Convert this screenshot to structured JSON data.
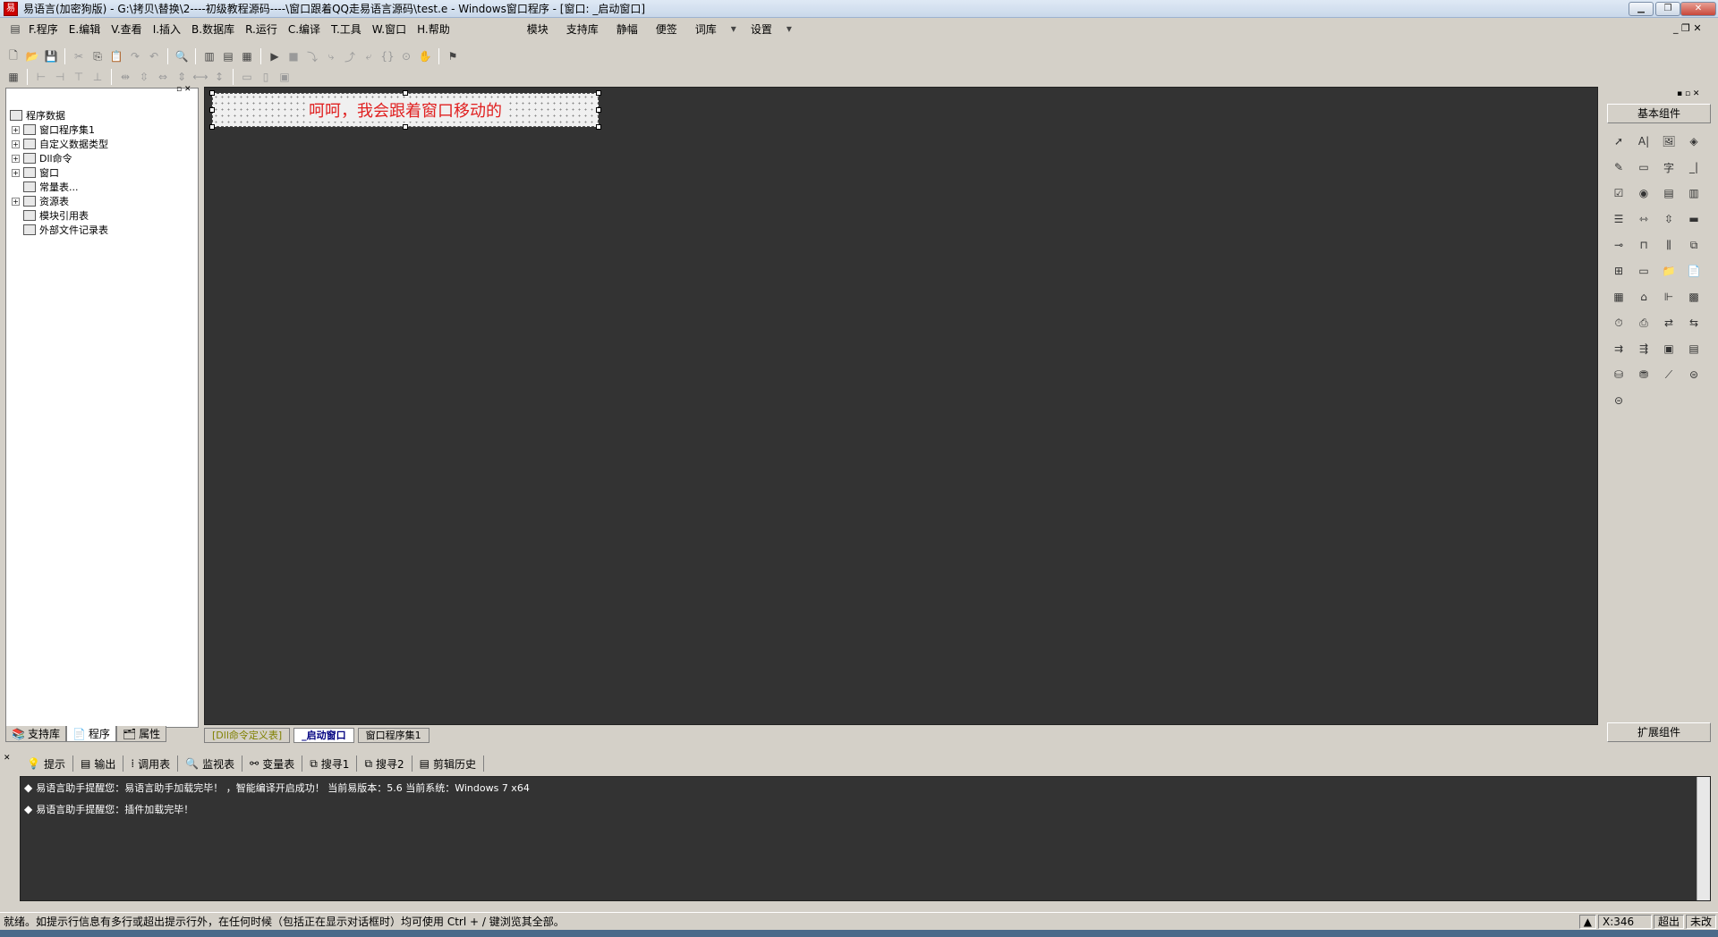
{
  "window": {
    "title": "易语言(加密狗版) - G:\\拷贝\\替换\\2----初级教程源码----\\窗口跟着QQ走易语言源码\\test.e - Windows窗口程序 - [窗口: _启动窗口]",
    "app_icon": "app-icon",
    "buttons": [
      "minimize",
      "restore",
      "close"
    ]
  },
  "menu": {
    "items": [
      "F.程序",
      "E.编辑",
      "V.查看",
      "I.插入",
      "B.数据库",
      "R.运行",
      "C.编译",
      "T.工具",
      "W.窗口",
      "H.帮助"
    ],
    "right_items": [
      "模块",
      "支持库",
      "静幅",
      "便签",
      "词库",
      "设置"
    ]
  },
  "tree": {
    "root": "程序数据",
    "items": [
      "窗口程序集1",
      "自定义数据类型",
      "Dll命令",
      "窗口",
      "常量表...",
      "资源表",
      "模块引用表",
      "外部文件记录表"
    ]
  },
  "left_tabs": [
    "支持库",
    "程序",
    "属性"
  ],
  "designer": {
    "label_text": "呵呵，我会跟着窗口移动的"
  },
  "doc_tabs": [
    "[Dll命令定义表]",
    "_启动窗口",
    "窗口程序集1"
  ],
  "components": {
    "header": "基本组件",
    "footer": "扩展组件"
  },
  "output": {
    "tabs": [
      "提示",
      "输出",
      "调用表",
      "监视表",
      "变量表",
      "搜寻1",
      "搜寻2",
      "剪辑历史"
    ],
    "lines": [
      "易语言助手提醒您：易语言助手加载完毕！ ，智能编译开启成功！ 当前易版本：5.6  当前系统：Windows 7 x64",
      "易语言助手提醒您：插件加载完毕！"
    ]
  },
  "status": {
    "text": "就绪。如提示行信息有多行或超出提示行外，在任何时候（包括正在显示对话框时）均可使用 Ctrl + / 键浏览其全部。",
    "coord": "X:346",
    "overwrite": "超出",
    "modified": "未改"
  },
  "colors": {
    "design_bg": "#333333",
    "label_text": "#e02020",
    "chrome": "#d4d0c8"
  }
}
